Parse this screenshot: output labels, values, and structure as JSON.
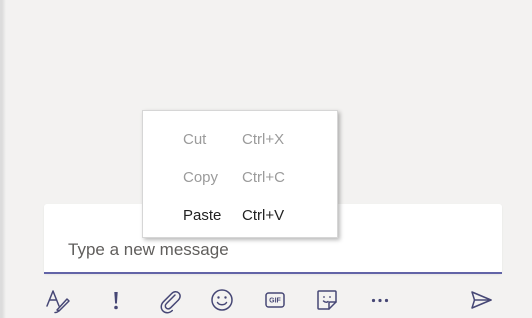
{
  "compose": {
    "placeholder": "Type a new message"
  },
  "context_menu": {
    "items": [
      {
        "label": "Cut",
        "shortcut": "Ctrl+X",
        "enabled": false
      },
      {
        "label": "Copy",
        "shortcut": "Ctrl+C",
        "enabled": false
      },
      {
        "label": "Paste",
        "shortcut": "Ctrl+V",
        "enabled": true
      }
    ]
  },
  "toolbar": {
    "icons": [
      "format-icon",
      "importance-icon",
      "attach-icon",
      "emoji-icon",
      "gif-icon",
      "sticker-icon",
      "more-options-icon",
      "send-icon"
    ],
    "gif_label": "GIF"
  },
  "colors": {
    "accent": "#6264a7",
    "icon": "#464775",
    "background": "#f3f2f1",
    "disabled_text": "#9b9b9b"
  }
}
